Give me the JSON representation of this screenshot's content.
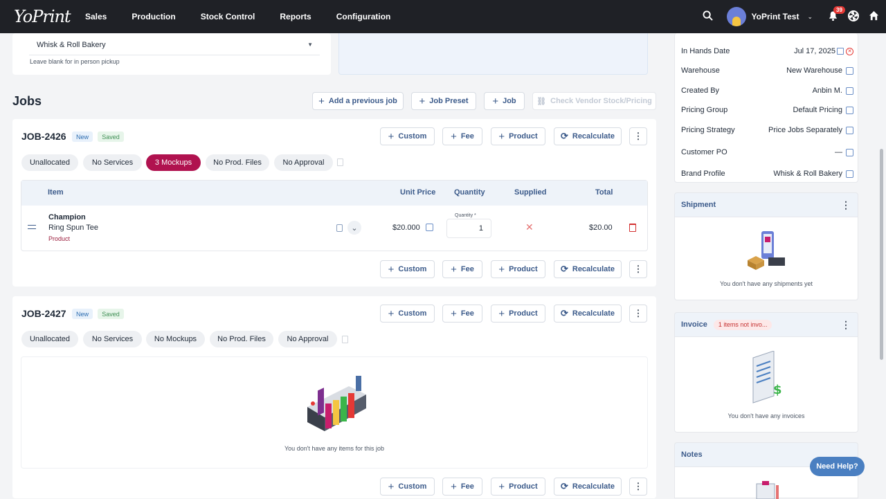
{
  "topbar": {
    "logo": "YoPrint",
    "nav": [
      "Sales",
      "Production",
      "Stock Control",
      "Reports",
      "Configuration"
    ],
    "user": "YoPrint Test",
    "notifications": "39",
    "icons": [
      "search-icon",
      "chevron-down-icon",
      "bell-icon",
      "aperture-icon",
      "home-icon"
    ]
  },
  "customer": {
    "value": "Whisk & Roll Bakery",
    "hint": "Leave blank for in person pickup"
  },
  "jobs": {
    "title": "Jobs",
    "add_previous": "Add a previous job",
    "job_preset": "Job Preset",
    "job": "Job",
    "check_vendor": "Check Vendor Stock/Pricing"
  },
  "actions": {
    "custom": "Custom",
    "fee": "Fee",
    "product": "Product",
    "recalculate": "Recalculate"
  },
  "job1": {
    "id": "JOB-2426",
    "status": "New",
    "saved": "Saved",
    "chips": [
      "Unallocated",
      "No Services",
      "3 Mockups",
      "No Prod. Files",
      "No Approval"
    ],
    "headers": {
      "item": "Item",
      "unit_price": "Unit Price",
      "quantity": "Quantity",
      "supplied": "Supplied",
      "total": "Total"
    },
    "row": {
      "brand": "Champion",
      "name": "Ring Spun Tee",
      "type": "Product",
      "unit_price": "$20.000",
      "qty_label": "Quantity *",
      "qty": "1",
      "total": "$20.00"
    }
  },
  "job2": {
    "id": "JOB-2427",
    "status": "New",
    "saved": "Saved",
    "chips": [
      "Unallocated",
      "No Services",
      "No Mockups",
      "No Prod. Files",
      "No Approval"
    ],
    "empty": "You don't have any items for this job"
  },
  "details": [
    {
      "label": "In Hands Date",
      "value": "Jul 17, 2025"
    },
    {
      "label": "Warehouse",
      "value": "New Warehouse"
    },
    {
      "label": "Created By",
      "value": "Anbin M."
    },
    {
      "label": "Pricing Group",
      "value": "Default Pricing"
    },
    {
      "label": "Pricing Strategy",
      "value": "Price Jobs Separately"
    },
    {
      "label": "Customer PO",
      "value": "—"
    },
    {
      "label": "Brand Profile",
      "value": "Whisk & Roll Bakery"
    }
  ],
  "shipment": {
    "title": "Shipment",
    "empty": "You don't have any shipments yet"
  },
  "invoice": {
    "title": "Invoice",
    "badge": "1 items not invo...",
    "empty": "You don't have any invoices"
  },
  "notes": {
    "title": "Notes"
  },
  "help": "Need Help?"
}
